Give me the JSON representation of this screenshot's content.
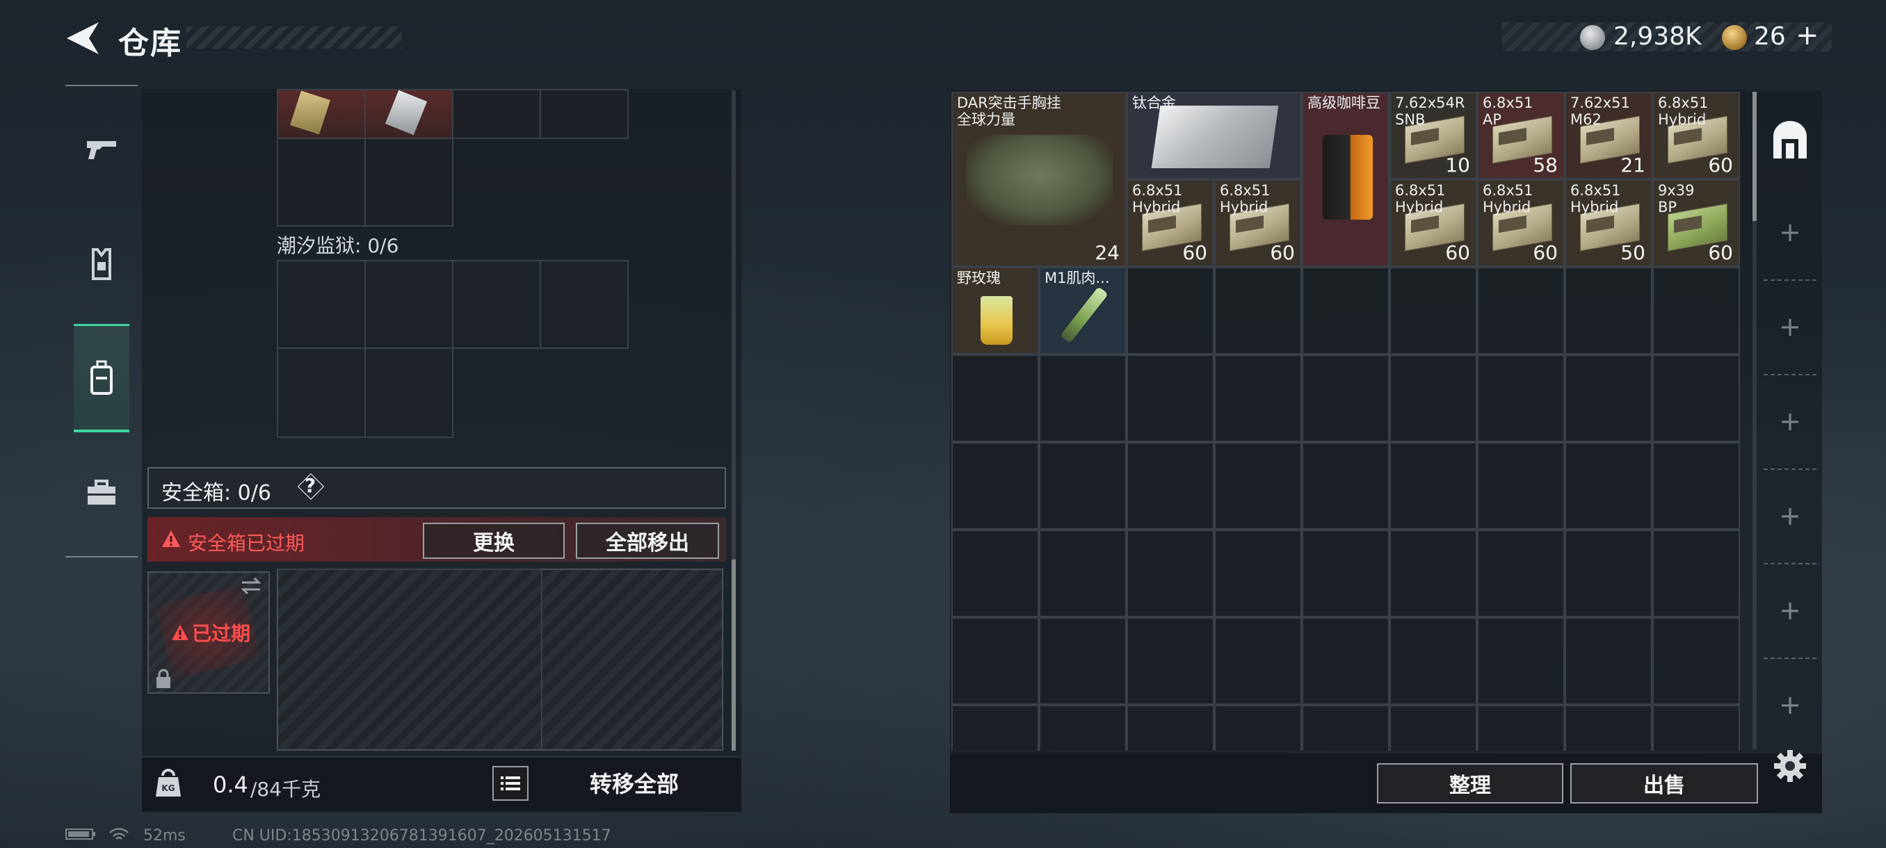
{
  "header": {
    "title": "仓库",
    "currency_silver": "2,938K",
    "currency_gold": "26",
    "currency_plus": "+"
  },
  "left_panel": {
    "tide_prison_label": "潮汐监狱: 0/6",
    "safe_box_label": "安全箱: 0/6",
    "safe_box_help": "?",
    "safe_box_expired_warning": "安全箱已过期",
    "replace_button": "更换",
    "move_all_out_button": "全部移出",
    "case_expired_label": "已过期",
    "weight_current": "0.4",
    "weight_max": "/84千克",
    "transfer_all_button": "转移全部"
  },
  "warehouse": {
    "items": [
      {
        "name": "DAR突击手胸挂\n全球力量",
        "count": "24",
        "bg": "#3b3329",
        "kind": "bag"
      },
      {
        "name": "钛合金",
        "count": "",
        "bg": "#2f3440",
        "kind": "plate"
      },
      {
        "name": "高级咖啡豆",
        "count": "",
        "bg": "#4a2a2e",
        "kind": "coffee"
      },
      {
        "name": "7.62x54R\nSNB",
        "count": "10",
        "bg": "#34302b",
        "kind": "ammo"
      },
      {
        "name": "6.8x51\nAP",
        "count": "58",
        "bg": "#4b2b2c",
        "kind": "ammo"
      },
      {
        "name": "7.62x51\nM62",
        "count": "21",
        "bg": "#3e2d28",
        "kind": "ammo"
      },
      {
        "name": "6.8x51\nHybrid",
        "count": "60",
        "bg": "#3a3329",
        "kind": "ammo"
      },
      {
        "name": "6.8x51\nHybrid",
        "count": "60",
        "bg": "#3a3329",
        "kind": "ammo"
      },
      {
        "name": "6.8x51\nHybrid",
        "count": "60",
        "bg": "#3a3329",
        "kind": "ammo"
      },
      {
        "name": "6.8x51\nHybrid",
        "count": "60",
        "bg": "#3a3329",
        "kind": "ammo"
      },
      {
        "name": "6.8x51\nHybrid",
        "count": "60",
        "bg": "#3a3329",
        "kind": "ammo"
      },
      {
        "name": "6.8x51\nHybrid",
        "count": "50",
        "bg": "#3a3329",
        "kind": "ammo"
      },
      {
        "name": "9x39\nBP",
        "count": "60",
        "bg": "#3a3329",
        "kind": "ammo-green"
      },
      {
        "name": "野玫瑰",
        "count": "",
        "bg": "#3a3329",
        "kind": "drink"
      },
      {
        "name": "M1肌肉...",
        "count": "",
        "bg": "#263340",
        "kind": "syringe"
      }
    ],
    "sort_button": "整理",
    "sell_button": "出售",
    "add_symbol": "+"
  },
  "status_bar": {
    "ping": "52ms",
    "uid": "CN UID:1853091320678139160​7_202605131517"
  },
  "colors": {
    "accent_green": "#3dd6a0",
    "warning_red": "#ff5a5a"
  }
}
